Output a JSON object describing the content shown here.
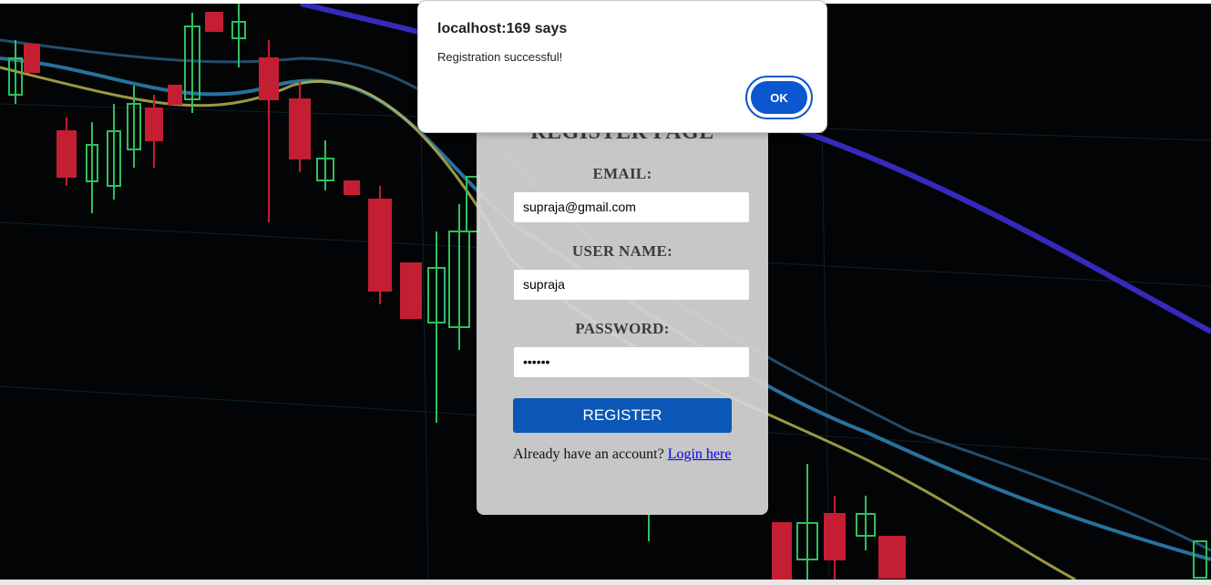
{
  "background": {
    "description_colors": {
      "bg": "#020406",
      "red": "#c41e33",
      "green": "#2fbf5e",
      "blue": "#3a8fc4",
      "purple": "#3b2fd1",
      "yellow": "#c9c25a"
    },
    "icon": "stock-candlestick-chart-image"
  },
  "form": {
    "title": "REGISTER PAGE",
    "email_label": "EMAIL:",
    "email_value": "supraja@gmail.com",
    "username_label": "USER NAME:",
    "username_value": "supraja",
    "password_label": "PASSWORD:",
    "password_value": "••••••",
    "register_label": "REGISTER",
    "already_text": "Already have an account?",
    "login_link": "Login here",
    "button_color": "#0b57b8"
  },
  "dialog": {
    "title": "localhost:169 says",
    "message": "Registration successful!",
    "ok_label": "OK",
    "accent": "#0b57d0"
  }
}
